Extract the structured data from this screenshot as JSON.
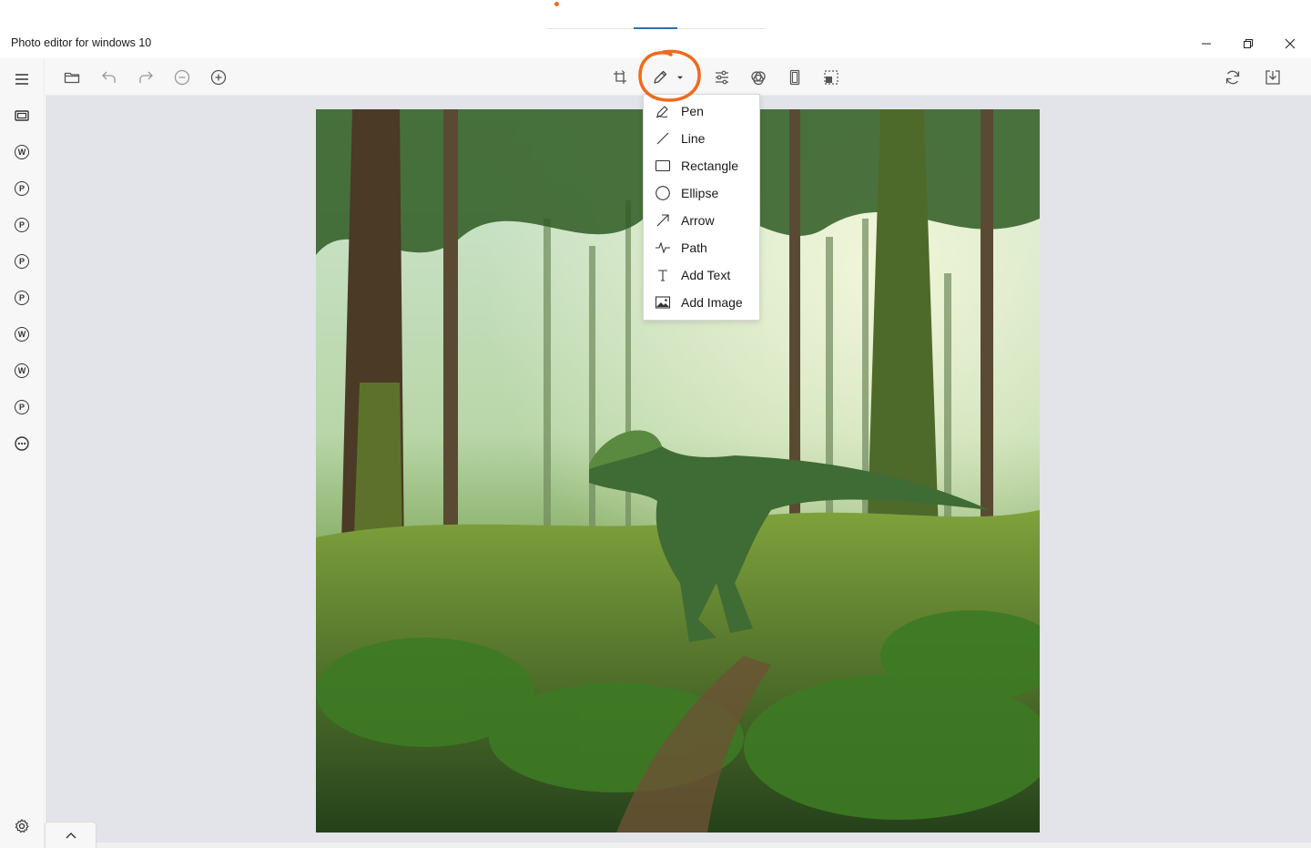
{
  "window": {
    "title": "Photo editor for windows 10",
    "controls": [
      "minimize-icon",
      "restore-icon",
      "close-icon"
    ]
  },
  "toolbar": {
    "left_icons": [
      "folder-open-icon",
      "undo-icon",
      "redo-icon",
      "zoom-out-icon",
      "zoom-in-icon"
    ],
    "center_icons": [
      "rotate-icon",
      "pen-icon",
      "dropdown-caret-icon",
      "adjust-sliders-icon",
      "filter-icon",
      "crop-portrait-icon",
      "select-region-icon"
    ],
    "right_icons": [
      "refresh-icon",
      "save-download-icon"
    ]
  },
  "rail": {
    "items": [
      {
        "icon": "menu-icon"
      },
      {
        "icon": "film-icon"
      },
      {
        "icon": "circle-letter-icon",
        "letter": "W"
      },
      {
        "icon": "circle-letter-icon",
        "letter": "P"
      },
      {
        "icon": "circle-letter-icon",
        "letter": "P"
      },
      {
        "icon": "circle-letter-icon",
        "letter": "P"
      },
      {
        "icon": "circle-letter-icon",
        "letter": "P"
      },
      {
        "icon": "circle-letter-icon",
        "letter": "W"
      },
      {
        "icon": "circle-letter-icon",
        "letter": "W"
      },
      {
        "icon": "circle-letter-icon",
        "letter": "P"
      },
      {
        "icon": "more-icon"
      }
    ],
    "settings_icon": "gear-icon"
  },
  "draw_menu": {
    "items": [
      {
        "label": "Pen",
        "icon": "pen-tool-icon"
      },
      {
        "label": "Line",
        "icon": "line-icon"
      },
      {
        "label": "Rectangle",
        "icon": "rectangle-icon"
      },
      {
        "label": "Ellipse",
        "icon": "ellipse-icon"
      },
      {
        "label": "Arrow",
        "icon": "arrow-icon"
      },
      {
        "label": "Path",
        "icon": "path-icon"
      },
      {
        "label": "Add Text",
        "icon": "text-icon"
      },
      {
        "label": "Add Image",
        "icon": "image-icon"
      }
    ]
  },
  "colors": {
    "annotation": "#f06a1c",
    "canvas_bg": "#e2e4e9",
    "accent": "#2b6fb3"
  }
}
